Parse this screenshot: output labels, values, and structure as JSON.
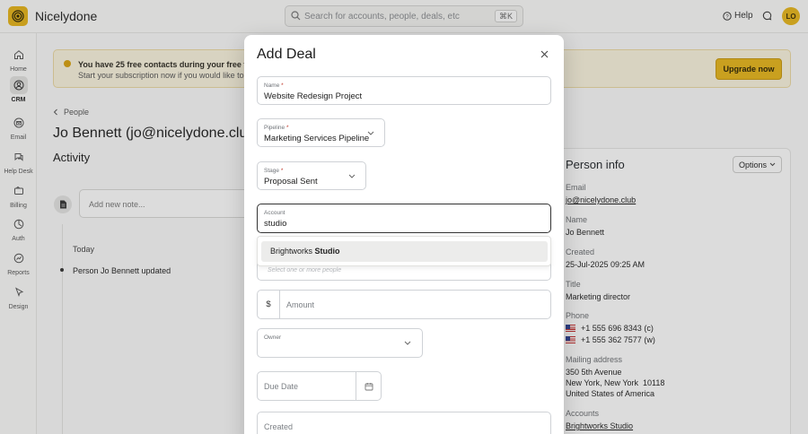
{
  "app": {
    "brand": "Nicelydone"
  },
  "topbar": {
    "search_placeholder": "Search for accounts, people, deals, etc",
    "search_shortcut": "⌘K",
    "help_label": "Help",
    "avatar_initials": "LO"
  },
  "sidebar": {
    "items": [
      {
        "label": "Home",
        "icon": "home-icon",
        "active": false
      },
      {
        "label": "CRM",
        "icon": "crm-icon",
        "active": true
      },
      {
        "label": "Email",
        "icon": "email-icon",
        "active": false
      },
      {
        "label": "Help Desk",
        "icon": "help-desk-icon",
        "active": false
      },
      {
        "label": "Billing",
        "icon": "billing-icon",
        "active": false
      },
      {
        "label": "Auth",
        "icon": "auth-icon",
        "active": false
      },
      {
        "label": "Reports",
        "icon": "reports-icon",
        "active": false
      },
      {
        "label": "Design",
        "icon": "design-icon",
        "active": false
      }
    ]
  },
  "banner": {
    "line1": "You have 25 free contacts during your free trial",
    "line2": "Start your subscription now if you would like to i",
    "upgrade_label": "Upgrade now"
  },
  "breadcrumb": {
    "label": "People"
  },
  "page": {
    "title": "Jo Bennett (jo@nicelydone.club)"
  },
  "activity": {
    "heading": "Activity",
    "note_placeholder": "Add new note...",
    "group_label": "Today",
    "events": [
      "Person Jo Bennett updated"
    ]
  },
  "person_info": {
    "title": "Person info",
    "options_label": "Options",
    "fields": {
      "email_label": "Email",
      "email": "jo@nicelydone.club",
      "name_label": "Name",
      "name": "Jo Bennett",
      "created_label": "Created",
      "created": "25-Jul-2025 09:25 AM",
      "title_label": "Title",
      "title": "Marketing director",
      "phone_label": "Phone",
      "phone1": "+1 555 696 8343 (c)",
      "phone2": "+1 555 362 7577 (w)",
      "address_label": "Mailing address",
      "address1": "350 5th Avenue",
      "address2": "New York, New York  10118",
      "address3": "United States of America",
      "accounts_label": "Accounts",
      "account": "Brightworks Studio"
    }
  },
  "modal": {
    "title": "Add Deal",
    "name_label": "Name",
    "name_value": "Website Redesign Project",
    "pipeline_label": "Pipeline",
    "pipeline_value": "Marketing Services Pipeline",
    "stage_label": "Stage",
    "stage_value": "Proposal Sent",
    "account_label": "Account",
    "account_value": "studio",
    "suggestion_prefix": "Brightworks ",
    "suggestion_match": "Studio",
    "people_placeholder": "Select one or more people",
    "amount_prefix": "$",
    "amount_placeholder": "Amount",
    "owner_label": "Owner",
    "due_date_placeholder": "Due Date",
    "created_placeholder": "Created",
    "required_mark": "*"
  },
  "colors": {
    "accent": "#e8b619",
    "banner_bg": "#fbf4df"
  }
}
